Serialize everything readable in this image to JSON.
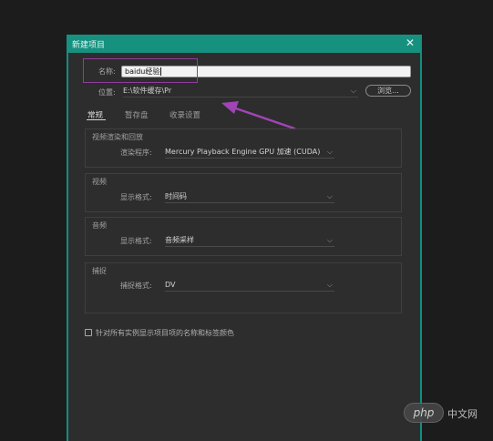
{
  "dialog": {
    "title": "新建项目",
    "close_glyph": "✕"
  },
  "name_field": {
    "label": "名称:",
    "value": "baidu经验"
  },
  "location": {
    "label": "位置:",
    "value": "E:\\软件缓存\\Pr",
    "browse_label": "浏览..."
  },
  "tabs": [
    {
      "label": "常规",
      "active": true
    },
    {
      "label": "暂存盘",
      "active": false
    },
    {
      "label": "收录设置",
      "active": false
    }
  ],
  "groups": {
    "render": {
      "title": "视频渲染和回放",
      "field_label": "渲染程序:",
      "value": "Mercury Playback Engine GPU 加速 (CUDA)"
    },
    "video": {
      "title": "视频",
      "field_label": "显示格式:",
      "value": "时间码"
    },
    "audio": {
      "title": "音频",
      "field_label": "显示格式:",
      "value": "音频采样"
    },
    "capture": {
      "title": "捕捉",
      "field_label": "捕捉格式:",
      "value": "DV"
    }
  },
  "checkbox": {
    "label": "针对所有实例显示项目项的名称和标签颜色",
    "checked": false
  },
  "watermark": {
    "badge": "php",
    "text": "中文网"
  },
  "colors": {
    "titlebar": "#16917f",
    "annotation": "#8f3d9c",
    "dialog_bg": "#2d2d2d"
  },
  "icons": {
    "close": "close-icon",
    "dropdown": "chevron-down-icon",
    "annotation_arrow": "arrow-icon"
  }
}
